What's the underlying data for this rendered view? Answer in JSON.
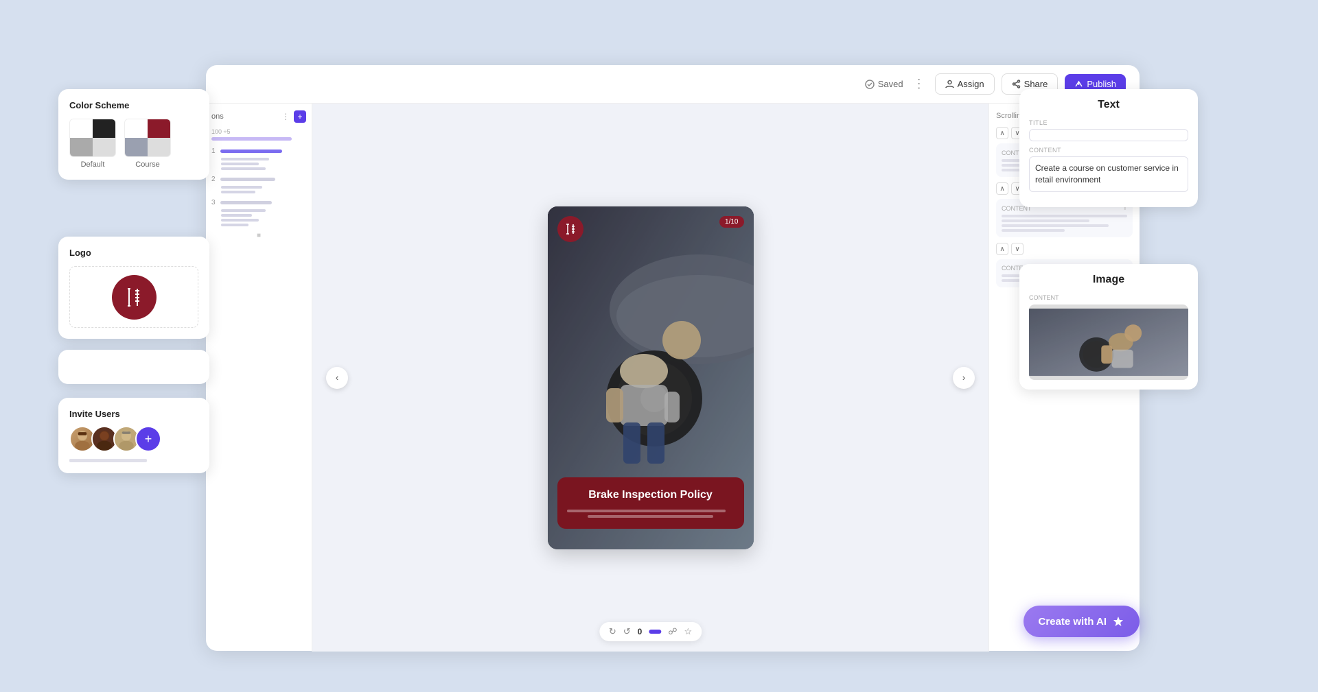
{
  "toolbar": {
    "status": "Saved",
    "assign_label": "Assign",
    "share_label": "Share",
    "publish_label": "Publish"
  },
  "left_panel": {
    "label": "ons",
    "add_icon": "+"
  },
  "slide": {
    "page_indicator": "1/10",
    "title": "Brake Inspection Policy"
  },
  "bottom_bar": {
    "count": "0",
    "page_num": "0"
  },
  "color_scheme": {
    "title": "Color Scheme",
    "default_label": "Default",
    "course_label": "Course"
  },
  "logo": {
    "title": "Logo"
  },
  "invite_users": {
    "title": "Invite Users"
  },
  "right_panel": {
    "scrolling_mix": "Scrolling mix",
    "text_section": {
      "title": "Text",
      "title_label": "TITLE",
      "content_label": "Content",
      "text_value": "Create a course on customer service in retail environment"
    },
    "image_section": {
      "title": "Image",
      "content_label": "CONTENT"
    },
    "create_ai_label": "Create with AI"
  }
}
